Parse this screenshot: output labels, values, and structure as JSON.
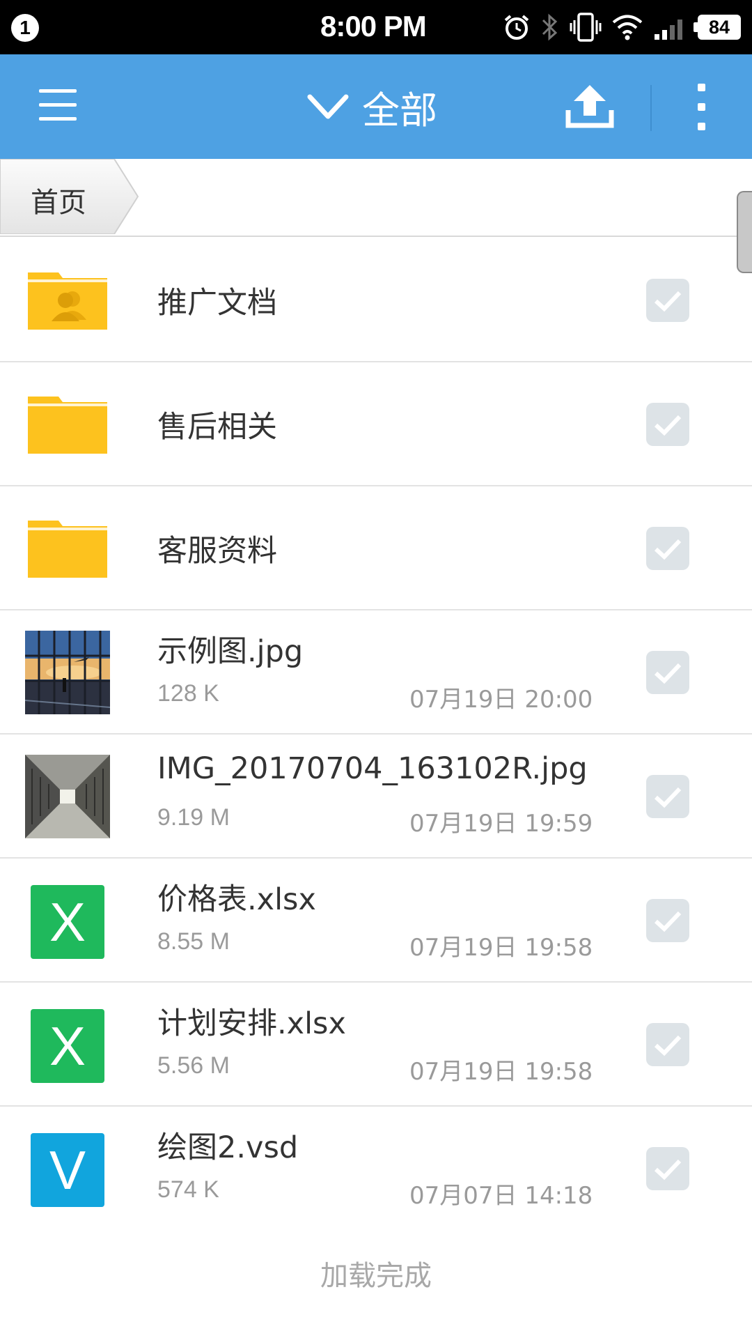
{
  "status_bar": {
    "notification_count": "1",
    "time": "8:00 PM",
    "battery_level": "84",
    "icons": [
      "alarm-icon",
      "bluetooth-icon",
      "vibrate-icon",
      "wifi-icon",
      "signal-icon",
      "battery-icon"
    ]
  },
  "app_bar": {
    "title": "全部",
    "icons": [
      "menu-icon",
      "chevron-down-icon",
      "upload-icon",
      "more-vert-icon"
    ],
    "color": "#4ea1e3"
  },
  "breadcrumb": {
    "home_label": "首页"
  },
  "files": [
    {
      "type": "folder",
      "icon": "shared-folder-icon",
      "name": "推广文档"
    },
    {
      "type": "folder",
      "icon": "folder-icon",
      "name": "售后相关"
    },
    {
      "type": "folder",
      "icon": "folder-icon",
      "name": "客服资料"
    },
    {
      "type": "image",
      "icon": "image-thumbnail",
      "name": "示例图.jpg",
      "size": "128 K",
      "date": "07月19日 20:00"
    },
    {
      "type": "image",
      "icon": "image-thumbnail",
      "name": "IMG_20170704_163102R.jpg",
      "size": "9.19 M",
      "date": "07月19日 19:59"
    },
    {
      "type": "excel",
      "icon": "excel-icon",
      "icon_letter": "X",
      "name": "价格表.xlsx",
      "size": "8.55 M",
      "date": "07月19日 19:58"
    },
    {
      "type": "excel",
      "icon": "excel-icon",
      "icon_letter": "X",
      "name": "计划安排.xlsx",
      "size": "5.56 M",
      "date": "07月19日 19:58"
    },
    {
      "type": "visio",
      "icon": "visio-icon",
      "icon_letter": "V",
      "name": "绘图2.vsd",
      "size": "574 K",
      "date": "07月07日 14:18"
    }
  ],
  "footer": {
    "load_status": "加载完成"
  },
  "colors": {
    "folder": "#fdc21e",
    "excel": "#1fb95c",
    "visio": "#11a5dd",
    "checkbox": "#dde3e7"
  }
}
